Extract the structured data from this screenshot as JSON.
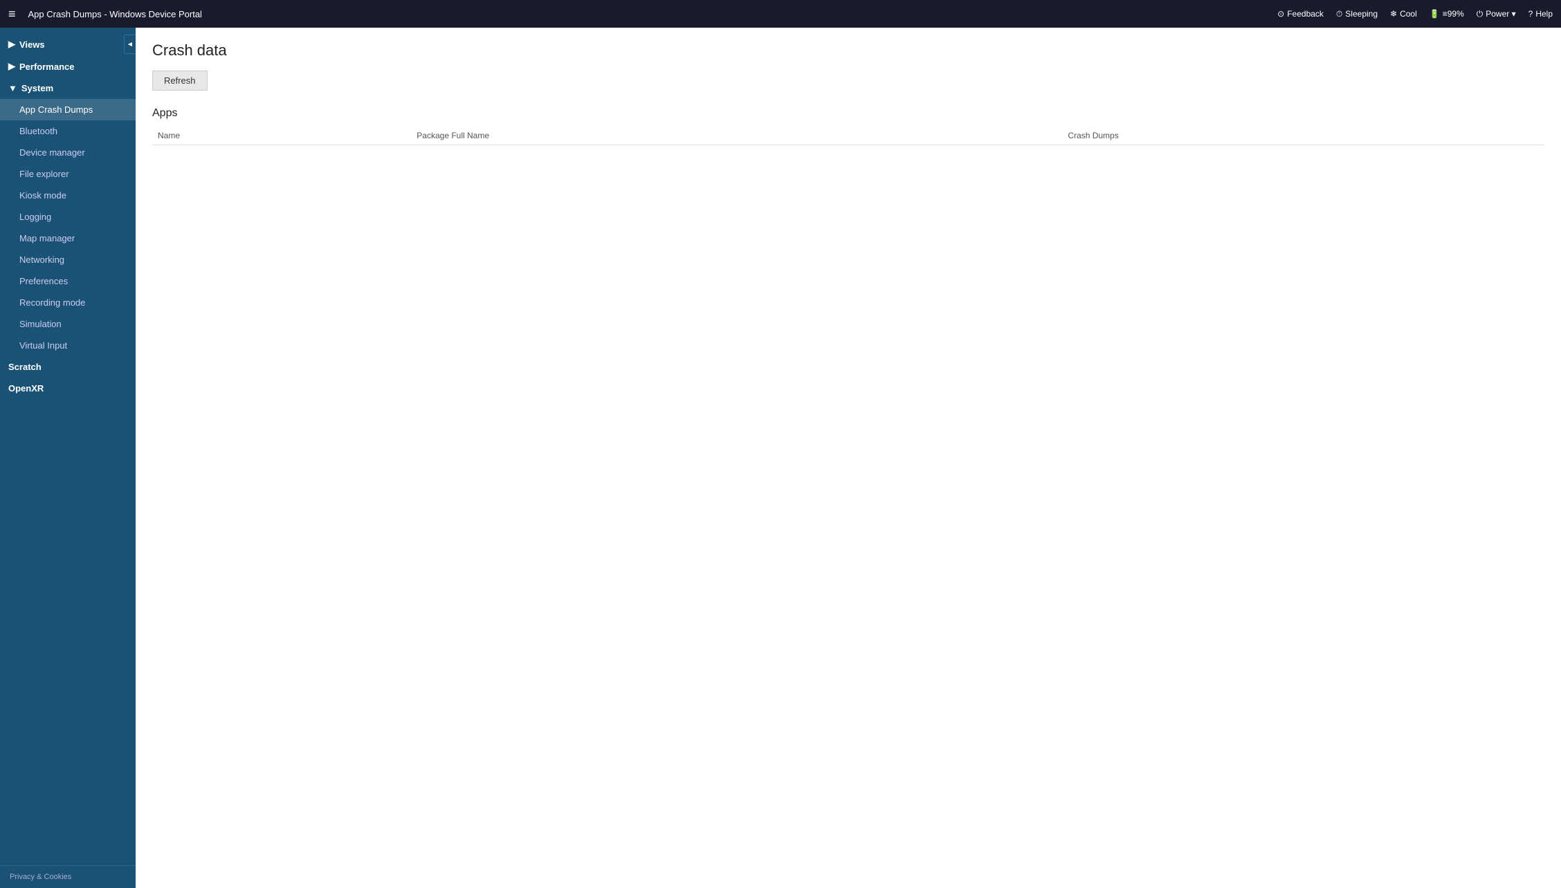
{
  "topbar": {
    "menu_icon": "≡",
    "title": "App Crash Dumps - Windows Device Portal",
    "actions": [
      {
        "icon": "⊙",
        "label": "Feedback"
      },
      {
        "icon": "⏱",
        "label": "Sleeping"
      },
      {
        "icon": "❄",
        "label": "Cool"
      },
      {
        "icon": "🔋",
        "label": "≡99%"
      },
      {
        "icon": "⏻",
        "label": "Power ▾"
      },
      {
        "icon": "?",
        "label": "Help"
      }
    ]
  },
  "sidebar": {
    "collapse_icon": "◄",
    "nav_items": [
      {
        "id": "views",
        "label": "▶ Views",
        "level": "top",
        "arrow": true
      },
      {
        "id": "performance",
        "label": "▶ Performance",
        "level": "top",
        "arrow": true
      },
      {
        "id": "system",
        "label": "▼ System",
        "level": "top",
        "arrow": true
      },
      {
        "id": "app-crash-dumps",
        "label": "App Crash Dumps",
        "level": "sub",
        "active": true
      },
      {
        "id": "bluetooth",
        "label": "Bluetooth",
        "level": "sub"
      },
      {
        "id": "device-manager",
        "label": "Device manager",
        "level": "sub"
      },
      {
        "id": "file-explorer",
        "label": "File explorer",
        "level": "sub"
      },
      {
        "id": "kiosk-mode",
        "label": "Kiosk mode",
        "level": "sub"
      },
      {
        "id": "logging",
        "label": "Logging",
        "level": "sub"
      },
      {
        "id": "map-manager",
        "label": "Map manager",
        "level": "sub"
      },
      {
        "id": "networking",
        "label": "Networking",
        "level": "sub"
      },
      {
        "id": "preferences",
        "label": "Preferences",
        "level": "sub"
      },
      {
        "id": "recording-mode",
        "label": "Recording mode",
        "level": "sub"
      },
      {
        "id": "simulation",
        "label": "Simulation",
        "level": "sub"
      },
      {
        "id": "virtual-input",
        "label": "Virtual Input",
        "level": "sub"
      },
      {
        "id": "scratch",
        "label": "Scratch",
        "level": "top"
      },
      {
        "id": "openxr",
        "label": "OpenXR",
        "level": "top"
      }
    ],
    "footer_label": "Privacy & Cookies"
  },
  "content": {
    "page_title": "Crash data",
    "refresh_button_label": "Refresh",
    "apps_section_title": "Apps",
    "table_columns": [
      {
        "id": "name",
        "label": "Name"
      },
      {
        "id": "package_full_name",
        "label": "Package Full Name"
      },
      {
        "id": "crash_dumps",
        "label": "Crash Dumps"
      }
    ],
    "table_rows": []
  }
}
